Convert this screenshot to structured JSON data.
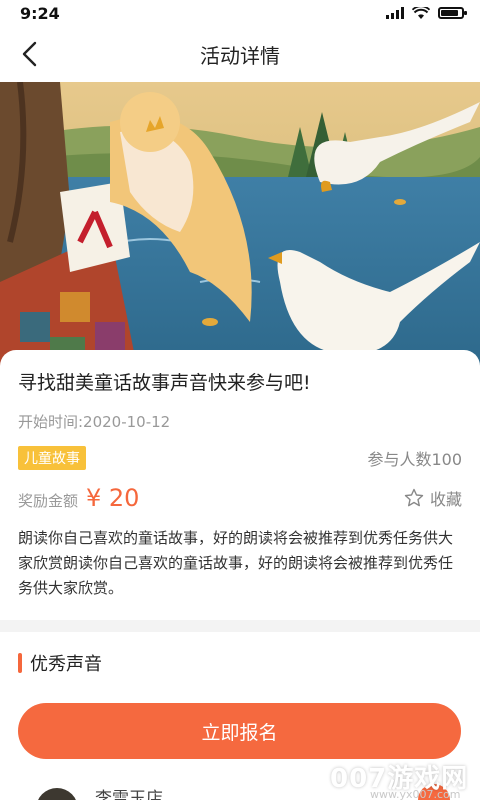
{
  "status_bar": {
    "time": "9:24",
    "battery_level": 0.85
  },
  "nav": {
    "title": "活动详情",
    "back_icon": "chevron-left-icon"
  },
  "hero": {
    "image_name": "fairy-tale-princess-swans-illustration"
  },
  "activity": {
    "title": "寻找甜美童话故事声音快来参与吧!",
    "start_time": "开始时间:2020-10-12",
    "tag": "儿童故事",
    "participants": "参与人数100",
    "reward_label": "奖励金额",
    "reward_amount": "¥ 20",
    "favorite_label": "收藏",
    "description": "朗读你自己喜欢的童话故事，好的朗读将会被推荐到优秀任务供大家欣赏朗读你自己喜欢的童话故事，好的朗读将会被推荐到优秀任务供大家欣赏。"
  },
  "section": {
    "title": "优秀声音"
  },
  "signup_button": "立即报名",
  "peek_item": {
    "name": "李雪玉店"
  },
  "watermark": {
    "text": "007游戏网",
    "url": "www.yx007.com"
  },
  "colors": {
    "accent": "#f5693f",
    "tag": "#f8c13a",
    "muted": "#999999"
  }
}
